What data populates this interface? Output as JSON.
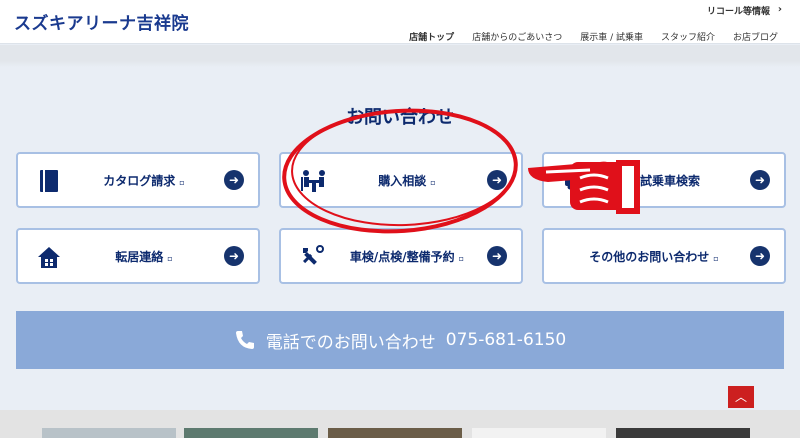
{
  "header": {
    "logo": "スズキアリーナ吉祥院",
    "recall_link": "リコール等情報",
    "nav": [
      "店舗トップ",
      "店舗からのごあいさつ",
      "展示車 / 試乗車",
      "スタッフ紹介",
      "お店ブログ"
    ]
  },
  "contact": {
    "title": "お問い合わせ",
    "cards": [
      {
        "label": "カタログ請求",
        "icon": "catalog-book-icon"
      },
      {
        "label": "購入相談",
        "icon": "consultation-icon"
      },
      {
        "label": "試乗車検索",
        "icon": "car-search-icon"
      },
      {
        "label": "転居連絡",
        "icon": "house-icon"
      },
      {
        "label": "車検/点検/整備予約",
        "icon": "wrench-icon"
      },
      {
        "label": "その他のお問い合わせ",
        "icon": "none"
      }
    ],
    "phone_label": "電話でのお問い合わせ",
    "phone_number": "075-681-6150"
  },
  "colors": {
    "navy": "#0d2a6e",
    "card_border": "#a8c0e4",
    "phone_bg": "#8aa9d8",
    "annotation_red": "#e0101a",
    "totop_bg": "#cc1f1f"
  }
}
